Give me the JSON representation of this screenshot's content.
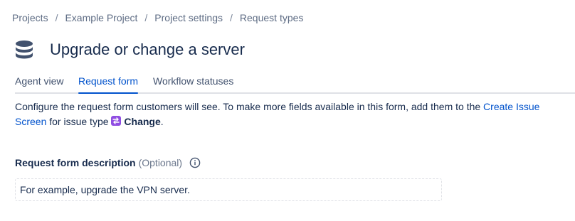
{
  "breadcrumb": {
    "items": [
      "Projects",
      "Example Project",
      "Project settings",
      "Request types"
    ],
    "separator": "/"
  },
  "header": {
    "icon": "database-icon",
    "title": "Upgrade or change a server"
  },
  "tabs": [
    {
      "label": "Agent view",
      "active": false
    },
    {
      "label": "Request form",
      "active": true
    },
    {
      "label": "Workflow statuses",
      "active": false
    }
  ],
  "description": {
    "text_before": "Configure the request form customers will see. To make more fields available in this form, add them to the ",
    "link": "Create Issue Screen",
    "text_middle": " for issue type ",
    "issue_type_icon": "change-icon",
    "issue_type": "Change",
    "text_after": "."
  },
  "field": {
    "label": "Request form description",
    "optional": "(Optional)",
    "info_icon": "info-icon",
    "value": "For example, upgrade the VPN server."
  },
  "colors": {
    "text": "#172b4d",
    "muted": "#5e6c84",
    "link": "#0052cc",
    "issue_type": "#904ee2",
    "border": "#dfe1e6"
  }
}
